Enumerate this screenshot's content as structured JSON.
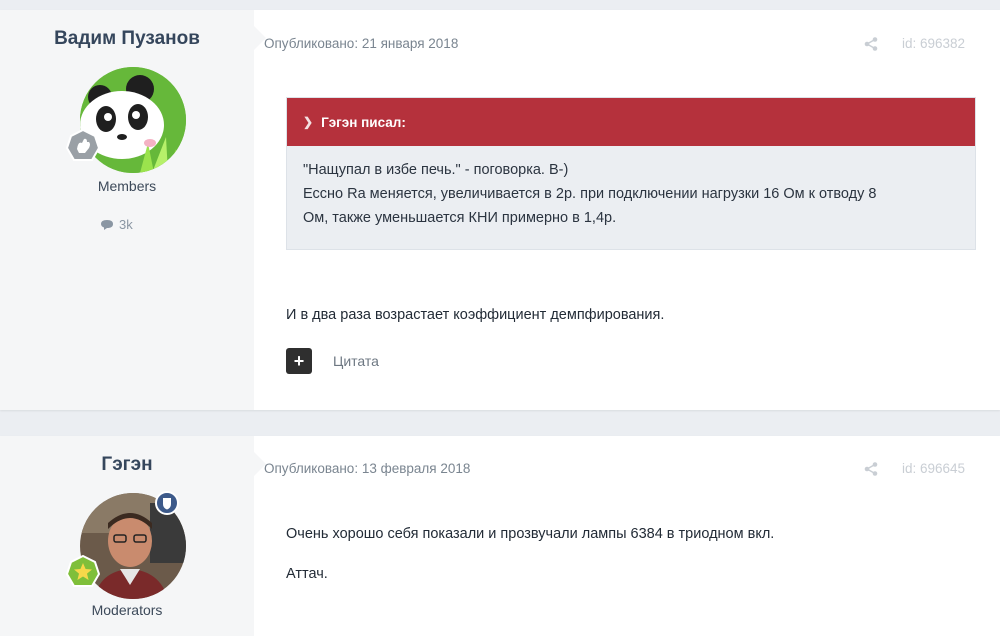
{
  "posts": [
    {
      "author": "Вадим Пузанов",
      "group": "Members",
      "post_count": "3k",
      "published": "Опубликовано: 21 января 2018",
      "id": "id: 696382",
      "quote": {
        "header": "Гэгэн писал:",
        "lines": [
          "\"Нащупал в избе печь.\" - поговорка. В-)",
          "Ессно Ra меняется, увеличивается в 2р. при подключении нагрузки 16 Ом к отводу 8",
          "Ом, также уменьшается КНИ примерно в 1,4р."
        ]
      },
      "text": "И в два раза возрастает коэффициент демпфирования.",
      "cite_label": "Цитата"
    },
    {
      "author": "Гэгэн",
      "group": "Moderators",
      "published": "Опубликовано: 13 февраля 2018",
      "id": "id: 696645",
      "lines": [
        "Очень хорошо себя показали и прозвучали лампы 6384 в триодном вкл.",
        "Аттач."
      ]
    }
  ],
  "colors": {
    "quote_header": "#b5313c",
    "author_bg": "#f5f6f7",
    "page_bg": "#ebeef2"
  }
}
